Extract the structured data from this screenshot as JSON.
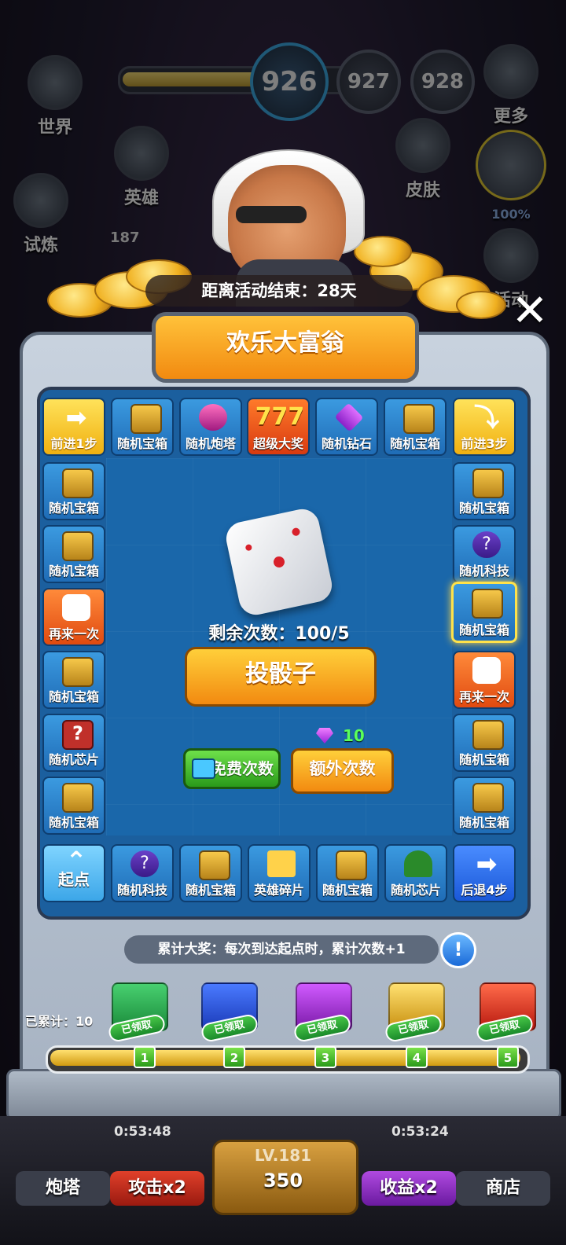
{
  "topbar": {
    "levels": [
      "926",
      "927",
      "928"
    ],
    "left_menu": [
      "世界",
      "试炼"
    ],
    "hero_label": "英雄",
    "hero_count": "187",
    "skin_label": "皮肤",
    "more_label": "更多",
    "event_label": "活动",
    "percent_label": "100%"
  },
  "event": {
    "end_text": "距离活动结束：28天",
    "title": "欢乐大富翁"
  },
  "board": {
    "top_row": [
      "前进1步",
      "随机宝箱",
      "随机炮塔",
      "超级大奖",
      "随机钻石",
      "随机宝箱",
      "前进3步"
    ],
    "left_col": [
      "随机宝箱",
      "随机宝箱",
      "再来一次",
      "随机宝箱",
      "随机芯片",
      "随机宝箱"
    ],
    "right_col": [
      "随机宝箱",
      "随机科技",
      "随机宝箱",
      "再来一次",
      "随机宝箱",
      "随机宝箱"
    ],
    "bottom_row": [
      "起点",
      "随机科技",
      "随机宝箱",
      "英雄碎片",
      "随机宝箱",
      "随机芯片",
      "后退4步"
    ],
    "jackpot_icon_text": "777"
  },
  "controls": {
    "remaining_label": "剩余次数：100/5",
    "roll_button": "投骰子",
    "free_button": "免费次数",
    "extra_button": "额外次数",
    "extra_cost": "10"
  },
  "accumulation": {
    "banner": "累计大奖：每次到达起点时，累计次数+1",
    "info_icon": "!",
    "count_label": "已累计：10",
    "rewards": [
      {
        "step": "1",
        "status": "已领取",
        "color": "#2fa84a"
      },
      {
        "step": "2",
        "status": "已领取",
        "color": "#2a5ad8"
      },
      {
        "step": "3",
        "status": "已领取",
        "color": "#a42ad0"
      },
      {
        "step": "4",
        "status": "已领取",
        "color": "#e8b82a"
      },
      {
        "step": "5",
        "status": "已领取",
        "color": "#d8302a"
      }
    ]
  },
  "bottombar": {
    "turret": "炮塔",
    "attack": "攻击x2",
    "timer_left": "0:53:48",
    "level": "LV.181",
    "coins": "350",
    "timer_right": "0:53:24",
    "income": "收益x2",
    "shop": "商店"
  },
  "colors": {
    "board_blue": "#1b5f9e",
    "title_orange": "#f28a10",
    "panel_gray": "#b6c0ce"
  }
}
